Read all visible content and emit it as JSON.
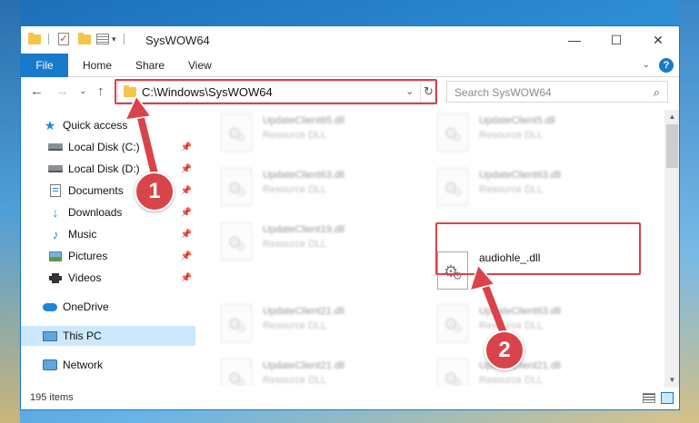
{
  "window": {
    "title": "SysWOW64",
    "minimize_glyph": "—",
    "maximize_glyph": "☐",
    "close_glyph": "✕"
  },
  "ribbon": {
    "tabs": [
      "File",
      "Home",
      "Share",
      "View"
    ],
    "expand_glyph": "⌄",
    "help_glyph": "?"
  },
  "nav": {
    "back_glyph": "←",
    "forward_glyph": "→",
    "recent_glyph": "⌄",
    "up_glyph": "↑",
    "address": "C:\\Windows\\SysWOW64",
    "dropdown_glyph": "⌄",
    "refresh_glyph": "↻",
    "search_placeholder": "Search SysWOW64",
    "search_glyph": "⌕"
  },
  "sidebar": {
    "items": [
      {
        "label": "Quick access",
        "icon": "star-icon",
        "pinned": false
      },
      {
        "label": "Local Disk (C:)",
        "icon": "disk-icon",
        "pinned": true
      },
      {
        "label": "Local Disk (D:)",
        "icon": "disk-icon",
        "pinned": true
      },
      {
        "label": "Documents",
        "icon": "documents-icon",
        "pinned": true
      },
      {
        "label": "Downloads",
        "icon": "download-icon",
        "pinned": true
      },
      {
        "label": "Music",
        "icon": "music-icon",
        "pinned": true
      },
      {
        "label": "Pictures",
        "icon": "pictures-icon",
        "pinned": true
      },
      {
        "label": "Videos",
        "icon": "videos-icon",
        "pinned": true
      },
      {
        "label": "OneDrive",
        "icon": "cloud-icon",
        "pinned": false
      },
      {
        "label": "This PC",
        "icon": "computer-icon",
        "pinned": false
      },
      {
        "label": "Network",
        "icon": "network-icon",
        "pinned": false
      }
    ],
    "pin_glyph": "📌",
    "star_glyph": "★",
    "download_glyph": "↓",
    "music_glyph": "♪"
  },
  "files": [
    {
      "name": "UpdateClient65.dll",
      "type": "Resource DLL"
    },
    {
      "name": "UpdateClient5.dll",
      "type": "Resource DLL"
    },
    {
      "name": "UpdateClient63.dll",
      "type": "Resource DLL"
    },
    {
      "name": "UpdateClient63.dll",
      "type": "Resource DLL"
    },
    {
      "name": "UpdateClient19.dll",
      "type": "Resource DLL"
    },
    {
      "name": "audiohle_.dll",
      "type": ""
    },
    {
      "name": "UpdateClient21.dll",
      "type": "Resource DLL"
    },
    {
      "name": "UpdateClient63.dll",
      "type": "Resource DLL"
    },
    {
      "name": "UpdateClient21.dll",
      "type": "Resource DLL"
    },
    {
      "name": "UpdateClient21.dll",
      "type": "Resource DLL"
    }
  ],
  "scroll": {
    "up_glyph": "▲",
    "down_glyph": "▼"
  },
  "status": {
    "item_count": "195 items"
  },
  "annotations": {
    "step1": "1",
    "step2": "2",
    "color": "#d9434a"
  }
}
